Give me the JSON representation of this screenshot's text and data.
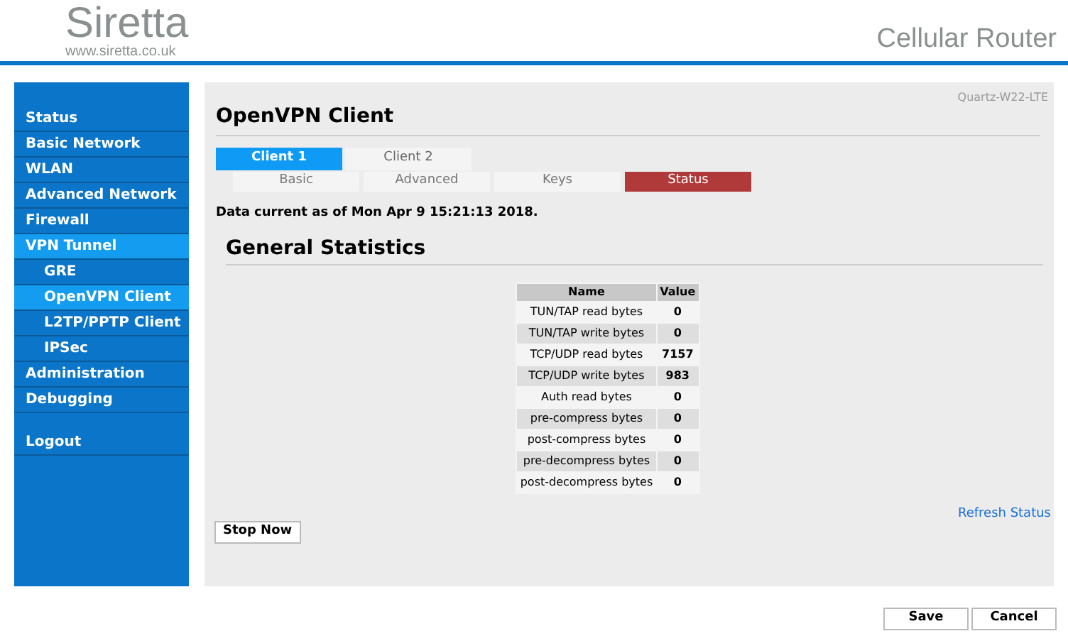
{
  "header": {
    "logo": "Siretta",
    "logo_url": "www.siretta.co.uk",
    "product": "Cellular Router"
  },
  "sidebar": {
    "items": [
      {
        "label": "Status",
        "kind": "top",
        "selected": false
      },
      {
        "label": "Basic Network",
        "kind": "top",
        "selected": false
      },
      {
        "label": "WLAN",
        "kind": "top",
        "selected": false
      },
      {
        "label": "Advanced Network",
        "kind": "top",
        "selected": false
      },
      {
        "label": "Firewall",
        "kind": "top",
        "selected": false
      },
      {
        "label": "VPN Tunnel",
        "kind": "top",
        "selected": true
      },
      {
        "label": "GRE",
        "kind": "sub",
        "selected": false
      },
      {
        "label": "OpenVPN Client",
        "kind": "sub",
        "selected": true
      },
      {
        "label": "L2TP/PPTP Client",
        "kind": "sub",
        "selected": false
      },
      {
        "label": "IPSec",
        "kind": "sub",
        "selected": false
      },
      {
        "label": "Administration",
        "kind": "top",
        "selected": false
      },
      {
        "label": "Debugging",
        "kind": "top",
        "selected": false
      },
      {
        "label": "Logout",
        "kind": "spaced",
        "selected": false
      }
    ]
  },
  "content": {
    "device": "Quartz-W22-LTE",
    "title": "OpenVPN Client",
    "tabs": [
      {
        "label": "Client 1",
        "selected": true
      },
      {
        "label": "Client 2",
        "selected": false
      }
    ],
    "subtabs": [
      {
        "label": "Basic",
        "selected": false
      },
      {
        "label": "Advanced",
        "selected": false
      },
      {
        "label": "Keys",
        "selected": false
      },
      {
        "label": "Status",
        "selected": true
      }
    ],
    "data_time": "Data current as of Mon Apr 9 15:21:13 2018.",
    "section": "General Statistics",
    "table": {
      "columns": [
        "Name",
        "Value"
      ],
      "rows": [
        [
          "TUN/TAP read bytes",
          "0"
        ],
        [
          "TUN/TAP write bytes",
          "0"
        ],
        [
          "TCP/UDP read bytes",
          "7157"
        ],
        [
          "TCP/UDP write bytes",
          "983"
        ],
        [
          "Auth read bytes",
          "0"
        ],
        [
          "pre-compress bytes",
          "0"
        ],
        [
          "post-compress bytes",
          "0"
        ],
        [
          "pre-decompress bytes",
          "0"
        ],
        [
          "post-decompress bytes",
          "0"
        ]
      ]
    },
    "refresh": "Refresh Status",
    "stop": "Stop Now"
  },
  "buttons": [
    "Save",
    "Cancel"
  ]
}
